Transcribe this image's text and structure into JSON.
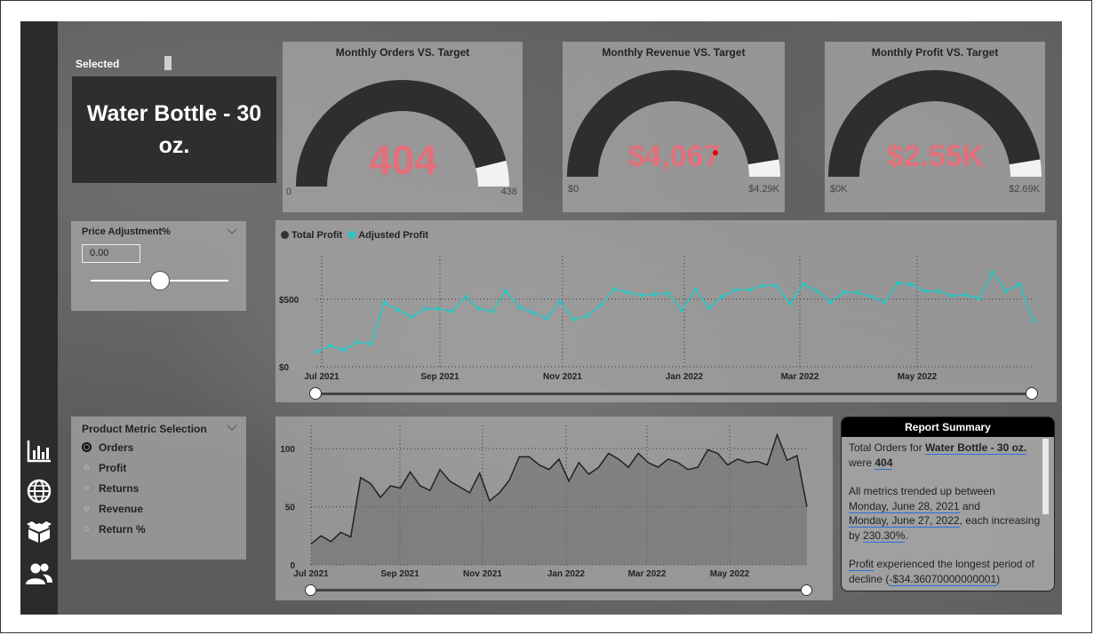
{
  "selected": {
    "label": "Selected",
    "product": "Water Bottle - 30 oz."
  },
  "gauges": [
    {
      "title": "Monthly Orders VS. Target",
      "value": "404",
      "min": "0",
      "max": "438",
      "fraction": 0.922
    },
    {
      "title": "Monthly Revenue VS. Target",
      "value": "$4,067",
      "min": "$0",
      "max": "$4.29K",
      "fraction": 0.948
    },
    {
      "title": "Monthly Profit VS. Target",
      "value": "$2.55K",
      "min": "$0K",
      "max": "$2.69K",
      "fraction": 0.948
    }
  ],
  "price_adjustment": {
    "title": "Price Adjustment%",
    "value": "0.00",
    "slider_fraction": 0.5
  },
  "metric_selection": {
    "title": "Product Metric Selection",
    "options": [
      "Orders",
      "Profit",
      "Returns",
      "Revenue",
      "Return %"
    ],
    "selected": "Orders"
  },
  "report": {
    "title": "Report Summary",
    "line1_prefix": "Total Orders for ",
    "line1_product": "Water Bottle - 30 oz.",
    "line2_prefix": "were ",
    "line2_value": "404",
    "p2_line1": "All metrics trended up between",
    "p2_date1": "Monday, June 28, 2021",
    "p2_and": " and",
    "p2_date2": "Monday, June 27, 2022",
    "p2_rest": ", each increasing",
    "p2_by": "by ",
    "p2_pct": "230.30%",
    "p2_end": ".",
    "p3_metric": "Profit",
    "p3_rest": " experienced the longest period of",
    "p3_line2": "decline (",
    "p3_value": "-$34.36070000000001",
    "p3_end": ")"
  },
  "colors": {
    "accent": "#2ec4c4",
    "gauge_value": "#e0707a",
    "gauge_arc": "#2e2e2e",
    "needle": "#e00000"
  },
  "chart_data": [
    {
      "type": "line",
      "legend": [
        "Total Profit",
        "Adjusted Profit"
      ],
      "y_ticks": [
        "$500",
        "$0"
      ],
      "x_ticks": [
        "Jul 2021",
        "Sep 2021",
        "Nov 2021",
        "Jan 2022",
        "Mar 2022",
        "May 2022"
      ],
      "ylim": [
        0,
        920
      ],
      "grid": true,
      "series": [
        {
          "name": "Adjusted Profit",
          "color": "#2ec4c4",
          "values": [
            110,
            155,
            125,
            185,
            170,
            475,
            420,
            370,
            430,
            430,
            410,
            515,
            430,
            410,
            560,
            440,
            400,
            360,
            480,
            350,
            375,
            455,
            575,
            550,
            530,
            535,
            545,
            420,
            570,
            435,
            520,
            570,
            570,
            600,
            600,
            470,
            610,
            560,
            480,
            550,
            550,
            520,
            480,
            620,
            610,
            560,
            560,
            525,
            530,
            505,
            700,
            560,
            610,
            345
          ]
        }
      ]
    },
    {
      "type": "area",
      "y_ticks": [
        "100",
        "50",
        "0"
      ],
      "x_ticks": [
        "Jul 2021",
        "Sep 2021",
        "Nov 2021",
        "Jan 2022",
        "Mar 2022",
        "May 2022"
      ],
      "ylim": [
        0,
        120
      ],
      "grid": true,
      "series": [
        {
          "name": "Orders",
          "values": [
            18,
            25,
            20,
            28,
            24,
            75,
            70,
            58,
            68,
            66,
            80,
            68,
            64,
            82,
            72,
            67,
            62,
            79,
            55,
            62,
            73,
            93,
            93,
            86,
            82,
            91,
            72,
            88,
            78,
            84,
            96,
            91,
            84,
            96,
            88,
            84,
            91,
            88,
            82,
            84,
            99,
            96,
            86,
            91,
            88,
            89,
            86,
            112,
            90,
            94,
            50
          ]
        }
      ]
    }
  ]
}
